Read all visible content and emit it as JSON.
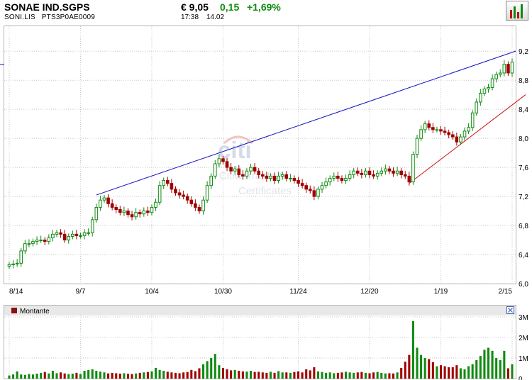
{
  "header": {
    "symbol": "SONAE IND.SGPS",
    "ticker": "SONI.LIS",
    "isin": "PTS3P0AE0009",
    "price": "€ 9,05",
    "change": "0,15",
    "change_pct": "+1,69%",
    "time": "17:38",
    "date": "14.02"
  },
  "watermark": {
    "brand": "citi",
    "line1": "Citiwarrants &",
    "line2": "Certificates"
  },
  "colors": {
    "up": "#118a11",
    "down": "#a00000",
    "resistance_line": "#1010c0",
    "support_line": "#d01010",
    "grid": "#c8c8c8",
    "volume_panel_header": "#e8e8e8"
  },
  "volume_panel": {
    "legend_label": "Montante"
  },
  "chart_data": [
    {
      "type": "candlestick",
      "x_tick_labels": [
        "8/14",
        "9/7",
        "10/4",
        "10/30",
        "11/24",
        "12/20",
        "1/19",
        "2/15"
      ],
      "y_tick_labels": [
        "9,2",
        "8,8",
        "8,4",
        "8,0",
        "7,6",
        "7,2",
        "6,8",
        "6,4",
        "6,0"
      ],
      "ylim": [
        6.0,
        9.3
      ],
      "grid": true,
      "close": [
        6.26,
        6.27,
        6.28,
        6.45,
        6.55,
        6.55,
        6.58,
        6.6,
        6.6,
        6.58,
        6.63,
        6.68,
        6.7,
        6.68,
        6.6,
        6.65,
        6.68,
        6.66,
        6.66,
        6.7,
        6.7,
        6.88,
        7.05,
        7.15,
        7.18,
        7.1,
        7.05,
        7.02,
        6.98,
        7.0,
        6.95,
        6.92,
        6.98,
        6.96,
        7.0,
        6.98,
        7.05,
        7.12,
        7.35,
        7.42,
        7.38,
        7.3,
        7.25,
        7.22,
        7.2,
        7.15,
        7.1,
        7.05,
        7.0,
        7.15,
        7.35,
        7.48,
        7.65,
        7.72,
        7.68,
        7.6,
        7.55,
        7.58,
        7.5,
        7.48,
        7.55,
        7.6,
        7.55,
        7.5,
        7.48,
        7.45,
        7.48,
        7.42,
        7.48,
        7.5,
        7.45,
        7.45,
        7.42,
        7.38,
        7.35,
        7.3,
        7.28,
        7.2,
        7.3,
        7.35,
        7.4,
        7.45,
        7.48,
        7.45,
        7.42,
        7.45,
        7.5,
        7.55,
        7.52,
        7.5,
        7.55,
        7.5,
        7.48,
        7.52,
        7.55,
        7.58,
        7.55,
        7.52,
        7.55,
        7.5,
        7.48,
        7.4,
        7.78,
        8.0,
        8.12,
        8.2,
        8.15,
        8.12,
        8.12,
        8.1,
        8.08,
        8.05,
        8.02,
        7.95,
        8.02,
        8.1,
        8.15,
        8.35,
        8.5,
        8.62,
        8.68,
        8.7,
        8.82,
        8.88,
        8.9,
        9.02,
        8.9,
        9.05
      ],
      "volume_axis_labels": [
        "3M",
        "2M",
        "1M",
        "0"
      ],
      "volume_ylim": [
        0,
        3000000
      ],
      "volume": [
        150000,
        200000,
        350000,
        200000,
        180000,
        220000,
        200000,
        240000,
        280000,
        320000,
        250000,
        380000,
        260000,
        300000,
        250000,
        220000,
        240000,
        280000,
        220000,
        380000,
        420000,
        450000,
        380000,
        340000,
        300000,
        250000,
        280000,
        260000,
        240000,
        260000,
        230000,
        220000,
        250000,
        280000,
        300000,
        320000,
        350000,
        520000,
        420000,
        380000,
        330000,
        300000,
        280000,
        260000,
        300000,
        320000,
        420000,
        360000,
        500000,
        700000,
        850000,
        1000000,
        1200000,
        650000,
        520000,
        450000,
        400000,
        420000,
        380000,
        350000,
        340000,
        380000,
        320000,
        330000,
        300000,
        280000,
        330000,
        280000,
        360000,
        300000,
        300000,
        280000,
        320000,
        350000,
        300000,
        450000,
        400000,
        550000,
        350000,
        320000,
        280000,
        300000,
        260000,
        280000,
        300000,
        330000,
        300000,
        280000,
        300000,
        320000,
        280000,
        260000,
        300000,
        320000,
        280000,
        250000,
        260000,
        250000,
        300000,
        520000,
        820000,
        1150000,
        2800000,
        1500000,
        1150000,
        1000000,
        950000,
        800000,
        600000,
        650000,
        600000,
        550000,
        550000,
        650000,
        500000,
        450000,
        600000,
        700000,
        900000,
        1100000,
        1400000,
        1500000,
        1350000,
        1000000,
        900000,
        1350000,
        500000,
        700000,
        500000
      ]
    }
  ]
}
